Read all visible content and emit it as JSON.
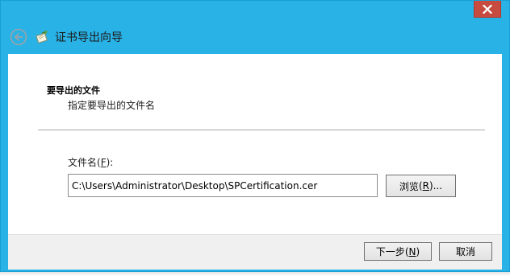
{
  "window": {
    "title": "证书导出向导"
  },
  "page": {
    "heading": "要导出的文件",
    "description": "指定要导出的文件名"
  },
  "file_field": {
    "label": "文件名",
    "label_mnemonic": "F",
    "value": "C:\\Users\\Administrator\\Desktop\\SPCertification.cer"
  },
  "buttons": {
    "browse_label": "浏览",
    "browse_mnemonic": "R",
    "next_label": "下一步",
    "next_mnemonic": "N",
    "cancel_label": "取消"
  },
  "icons": {
    "back": "back-arrow-icon",
    "wizard": "certificate-wizard-icon",
    "close": "close-icon"
  },
  "colors": {
    "title_bar": "#29b2e5",
    "close_button": "#c74b3f",
    "footer": "#f0f0f0"
  }
}
